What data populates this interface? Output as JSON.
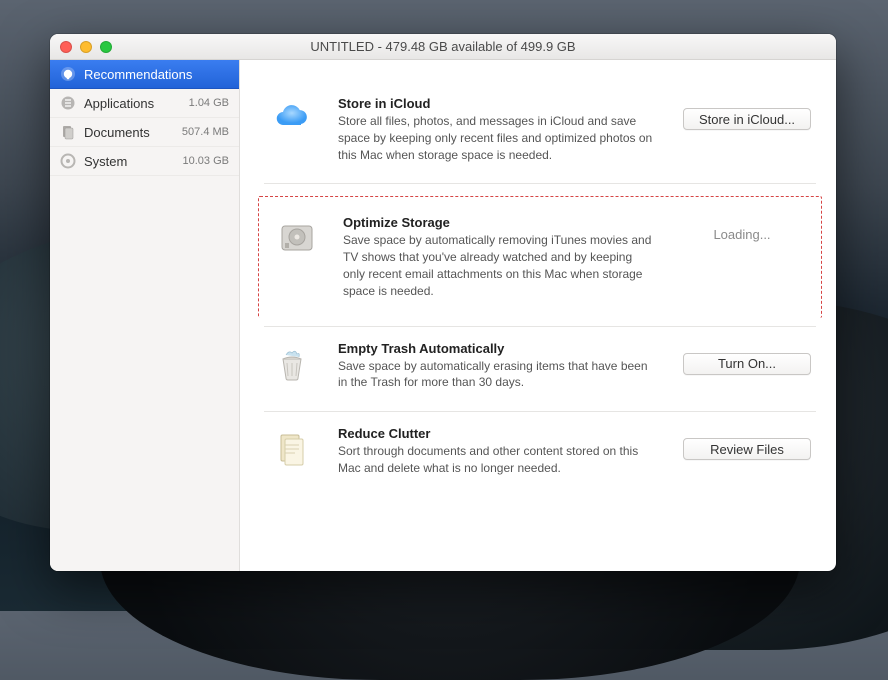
{
  "window_title": "UNTITLED - 479.48 GB available of 499.9 GB",
  "sidebar": {
    "items": [
      {
        "label": "Recommendations",
        "size": "",
        "selected": true
      },
      {
        "label": "Applications",
        "size": "1.04 GB",
        "selected": false
      },
      {
        "label": "Documents",
        "size": "507.4 MB",
        "selected": false
      },
      {
        "label": "System",
        "size": "10.03 GB",
        "selected": false
      }
    ]
  },
  "cards": {
    "icloud": {
      "title": "Store in iCloud",
      "desc": "Store all files, photos, and messages in iCloud and save space by keeping only recent files and optimized photos on this Mac when storage space is needed.",
      "button": "Store in iCloud..."
    },
    "optimize": {
      "title": "Optimize Storage",
      "desc": "Save space by automatically removing iTunes movies and TV shows that you've already watched and by keeping only recent email attachments on this Mac when storage space is needed.",
      "status": "Loading..."
    },
    "trash": {
      "title": "Empty Trash Automatically",
      "desc": "Save space by automatically erasing items that have been in the Trash for more than 30 days.",
      "button": "Turn On..."
    },
    "clutter": {
      "title": "Reduce Clutter",
      "desc": "Sort through documents and other content stored on this Mac and delete what is no longer needed.",
      "button": "Review Files"
    }
  }
}
